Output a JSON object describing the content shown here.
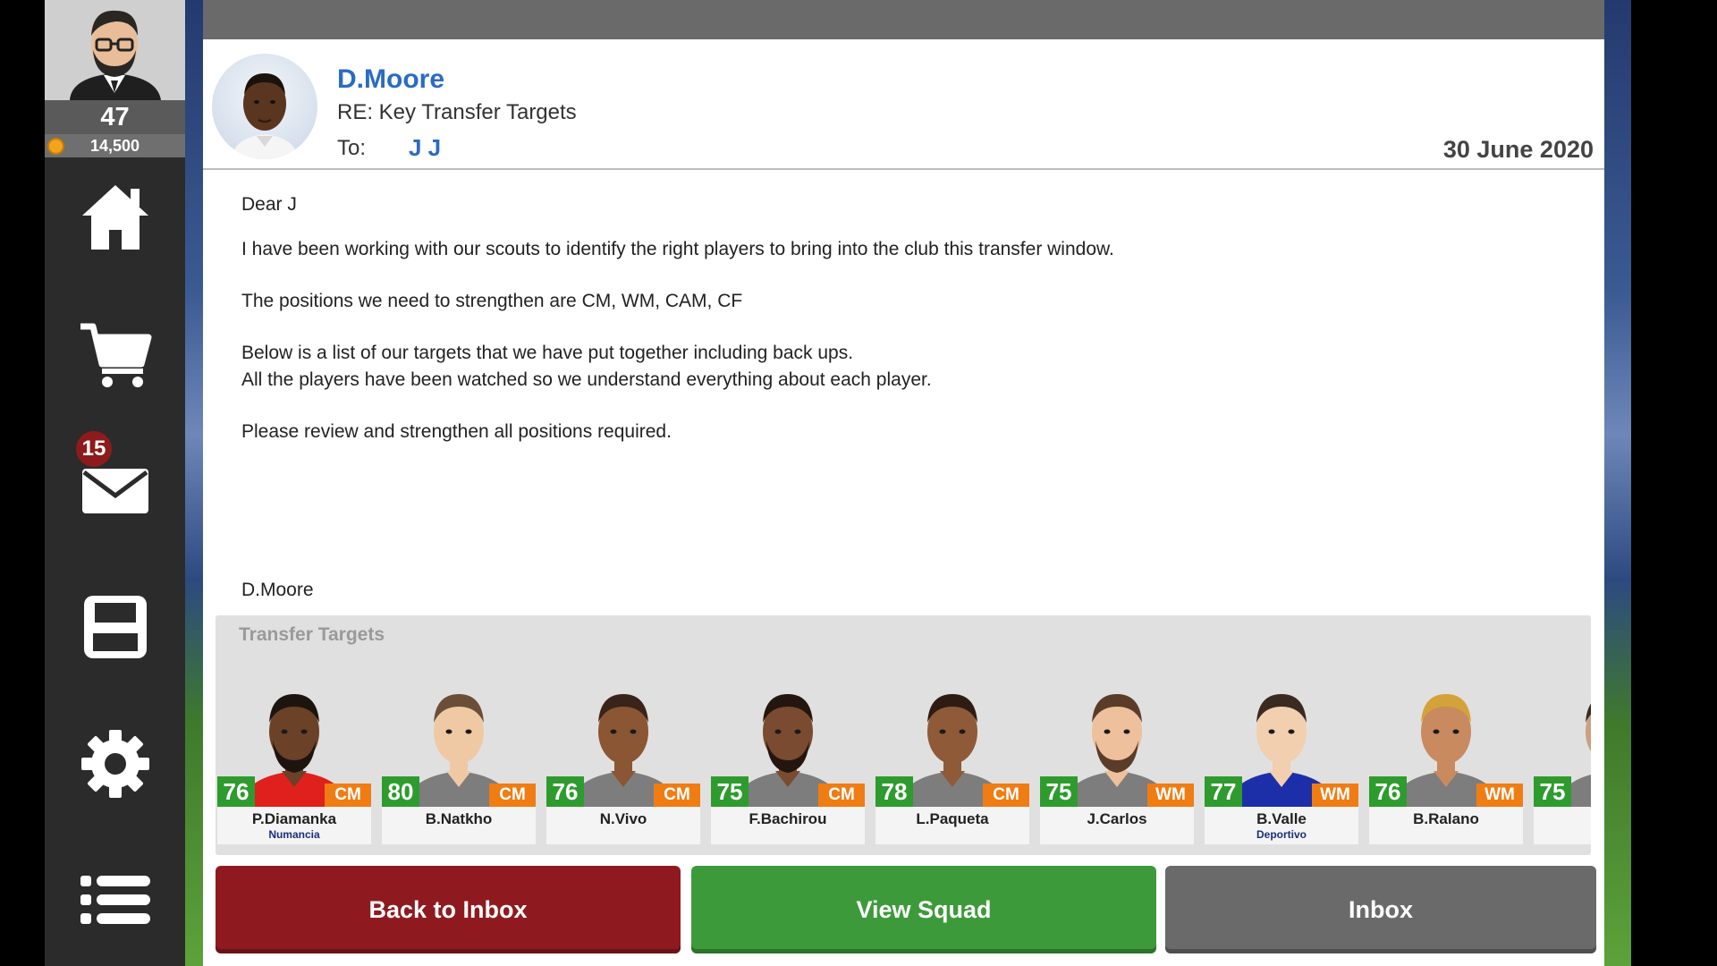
{
  "user": {
    "level": "47",
    "coins": "14,500"
  },
  "sidebar": {
    "mail_badge": "15",
    "icons": [
      "home-icon",
      "cart-icon",
      "mail-icon",
      "save-icon",
      "gear-icon",
      "list-icon"
    ]
  },
  "message": {
    "sender": "D.Moore",
    "subject": "RE: Key Transfer Targets",
    "to_label": "To:",
    "to_value": "J J",
    "date": "30 June 2020",
    "greeting": "Dear J",
    "line1": "I have been working with our scouts to identify the right players to bring into the club this transfer window.",
    "line2": "The positions we need to strengthen are CM, WM, CAM, CF",
    "line3": "Below is a list of our targets that we have put together including back ups.",
    "line4": "All the players have been watched so we understand everything about each player.",
    "line5": "Please review and strengthen all positions required.",
    "signature": "D.Moore"
  },
  "targets": {
    "title": "Transfer Targets",
    "players": [
      {
        "name": "P.Diamanka",
        "club": "Numancia",
        "rating": "76",
        "pos": "CM",
        "skin": "#6b4128",
        "hair": "#1d1410",
        "shirt": "#e0201c",
        "beard": true
      },
      {
        "name": "B.Natkho",
        "club": "",
        "rating": "80",
        "pos": "CM",
        "skin": "#efc9a4",
        "hair": "#6a4e38",
        "shirt": "#7d7d7d",
        "beard": false
      },
      {
        "name": "N.Vivo",
        "club": "",
        "rating": "76",
        "pos": "CM",
        "skin": "#8a5634",
        "hair": "#3a2318",
        "shirt": "#7d7d7d",
        "beard": false
      },
      {
        "name": "F.Bachirou",
        "club": "",
        "rating": "75",
        "pos": "CM",
        "skin": "#7a4b30",
        "hair": "#24160e",
        "shirt": "#7d7d7d",
        "beard": true
      },
      {
        "name": "L.Paqueta",
        "club": "",
        "rating": "78",
        "pos": "CM",
        "skin": "#8f5a38",
        "hair": "#2e1c12",
        "shirt": "#7d7d7d",
        "beard": false
      },
      {
        "name": "J.Carlos",
        "club": "",
        "rating": "75",
        "pos": "WM",
        "skin": "#eec09c",
        "hair": "#5b3c28",
        "shirt": "#7d7d7d",
        "beard": true
      },
      {
        "name": "B.Valle",
        "club": "Deportivo",
        "rating": "77",
        "pos": "WM",
        "skin": "#f2cfae",
        "hair": "#3b2a20",
        "shirt": "#1d2fa8",
        "beard": false
      },
      {
        "name": "B.Ralano",
        "club": "",
        "rating": "76",
        "pos": "WM",
        "skin": "#c98a60",
        "hair": "#d4a23a",
        "shirt": "#7d7d7d",
        "beard": false
      },
      {
        "name": "",
        "club": "",
        "rating": "75",
        "pos": "",
        "skin": "#caa080",
        "hair": "#3a2a1f",
        "shirt": "#7d7d7d",
        "beard": false
      }
    ]
  },
  "buttons": {
    "back": "Back to Inbox",
    "squad": "View Squad",
    "inbox": "Inbox"
  }
}
